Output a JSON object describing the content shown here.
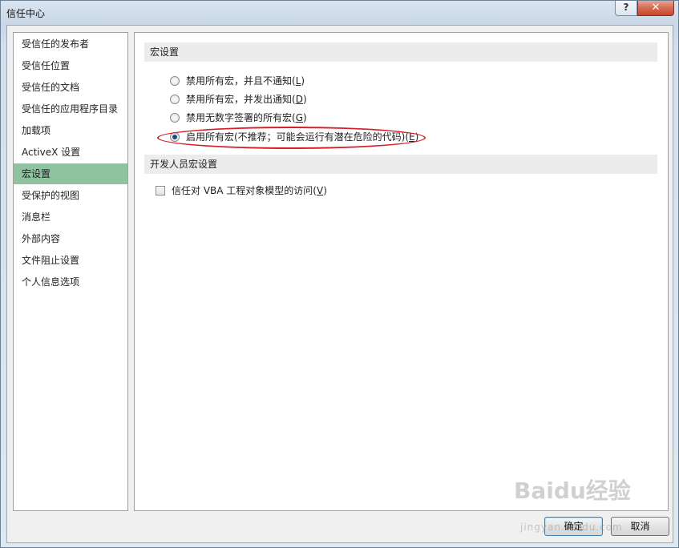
{
  "window": {
    "title": "信任中心",
    "help_label": "?",
    "close_label": "✕"
  },
  "sidebar": {
    "selected_index": 6,
    "items": [
      {
        "label": "受信任的发布者"
      },
      {
        "label": "受信任位置"
      },
      {
        "label": "受信任的文档"
      },
      {
        "label": "受信任的应用程序目录"
      },
      {
        "label": "加载项"
      },
      {
        "label": "ActiveX 设置"
      },
      {
        "label": "宏设置"
      },
      {
        "label": "受保护的视图"
      },
      {
        "label": "消息栏"
      },
      {
        "label": "外部内容"
      },
      {
        "label": "文件阻止设置"
      },
      {
        "label": "个人信息选项"
      }
    ]
  },
  "macro_settings": {
    "header": "宏设置",
    "options": [
      {
        "text": "禁用所有宏，并且不通知(",
        "key": "L",
        "end": ")",
        "checked": false
      },
      {
        "text": "禁用所有宏，并发出通知(",
        "key": "D",
        "end": ")",
        "checked": false
      },
      {
        "text": "禁用无数字签署的所有宏(",
        "key": "G",
        "end": ")",
        "checked": false
      },
      {
        "text": "启用所有宏(不推荐；可能会运行有潜在危险的代码)(",
        "key": "E",
        "end": ")",
        "checked": true
      }
    ]
  },
  "developer_settings": {
    "header": "开发人员宏设置",
    "checkbox": {
      "text": "信任对 VBA 工程对象模型的访问(",
      "key": "V",
      "end": ")",
      "checked": false
    }
  },
  "buttons": {
    "ok_label": "确定",
    "cancel_label": "取消"
  },
  "watermark": {
    "text": "Baidu经验",
    "sub": "jingyan.baidu.com"
  },
  "colors": {
    "selected_nav": "#8fc2a0",
    "highlight_ring": "#d3202a"
  }
}
